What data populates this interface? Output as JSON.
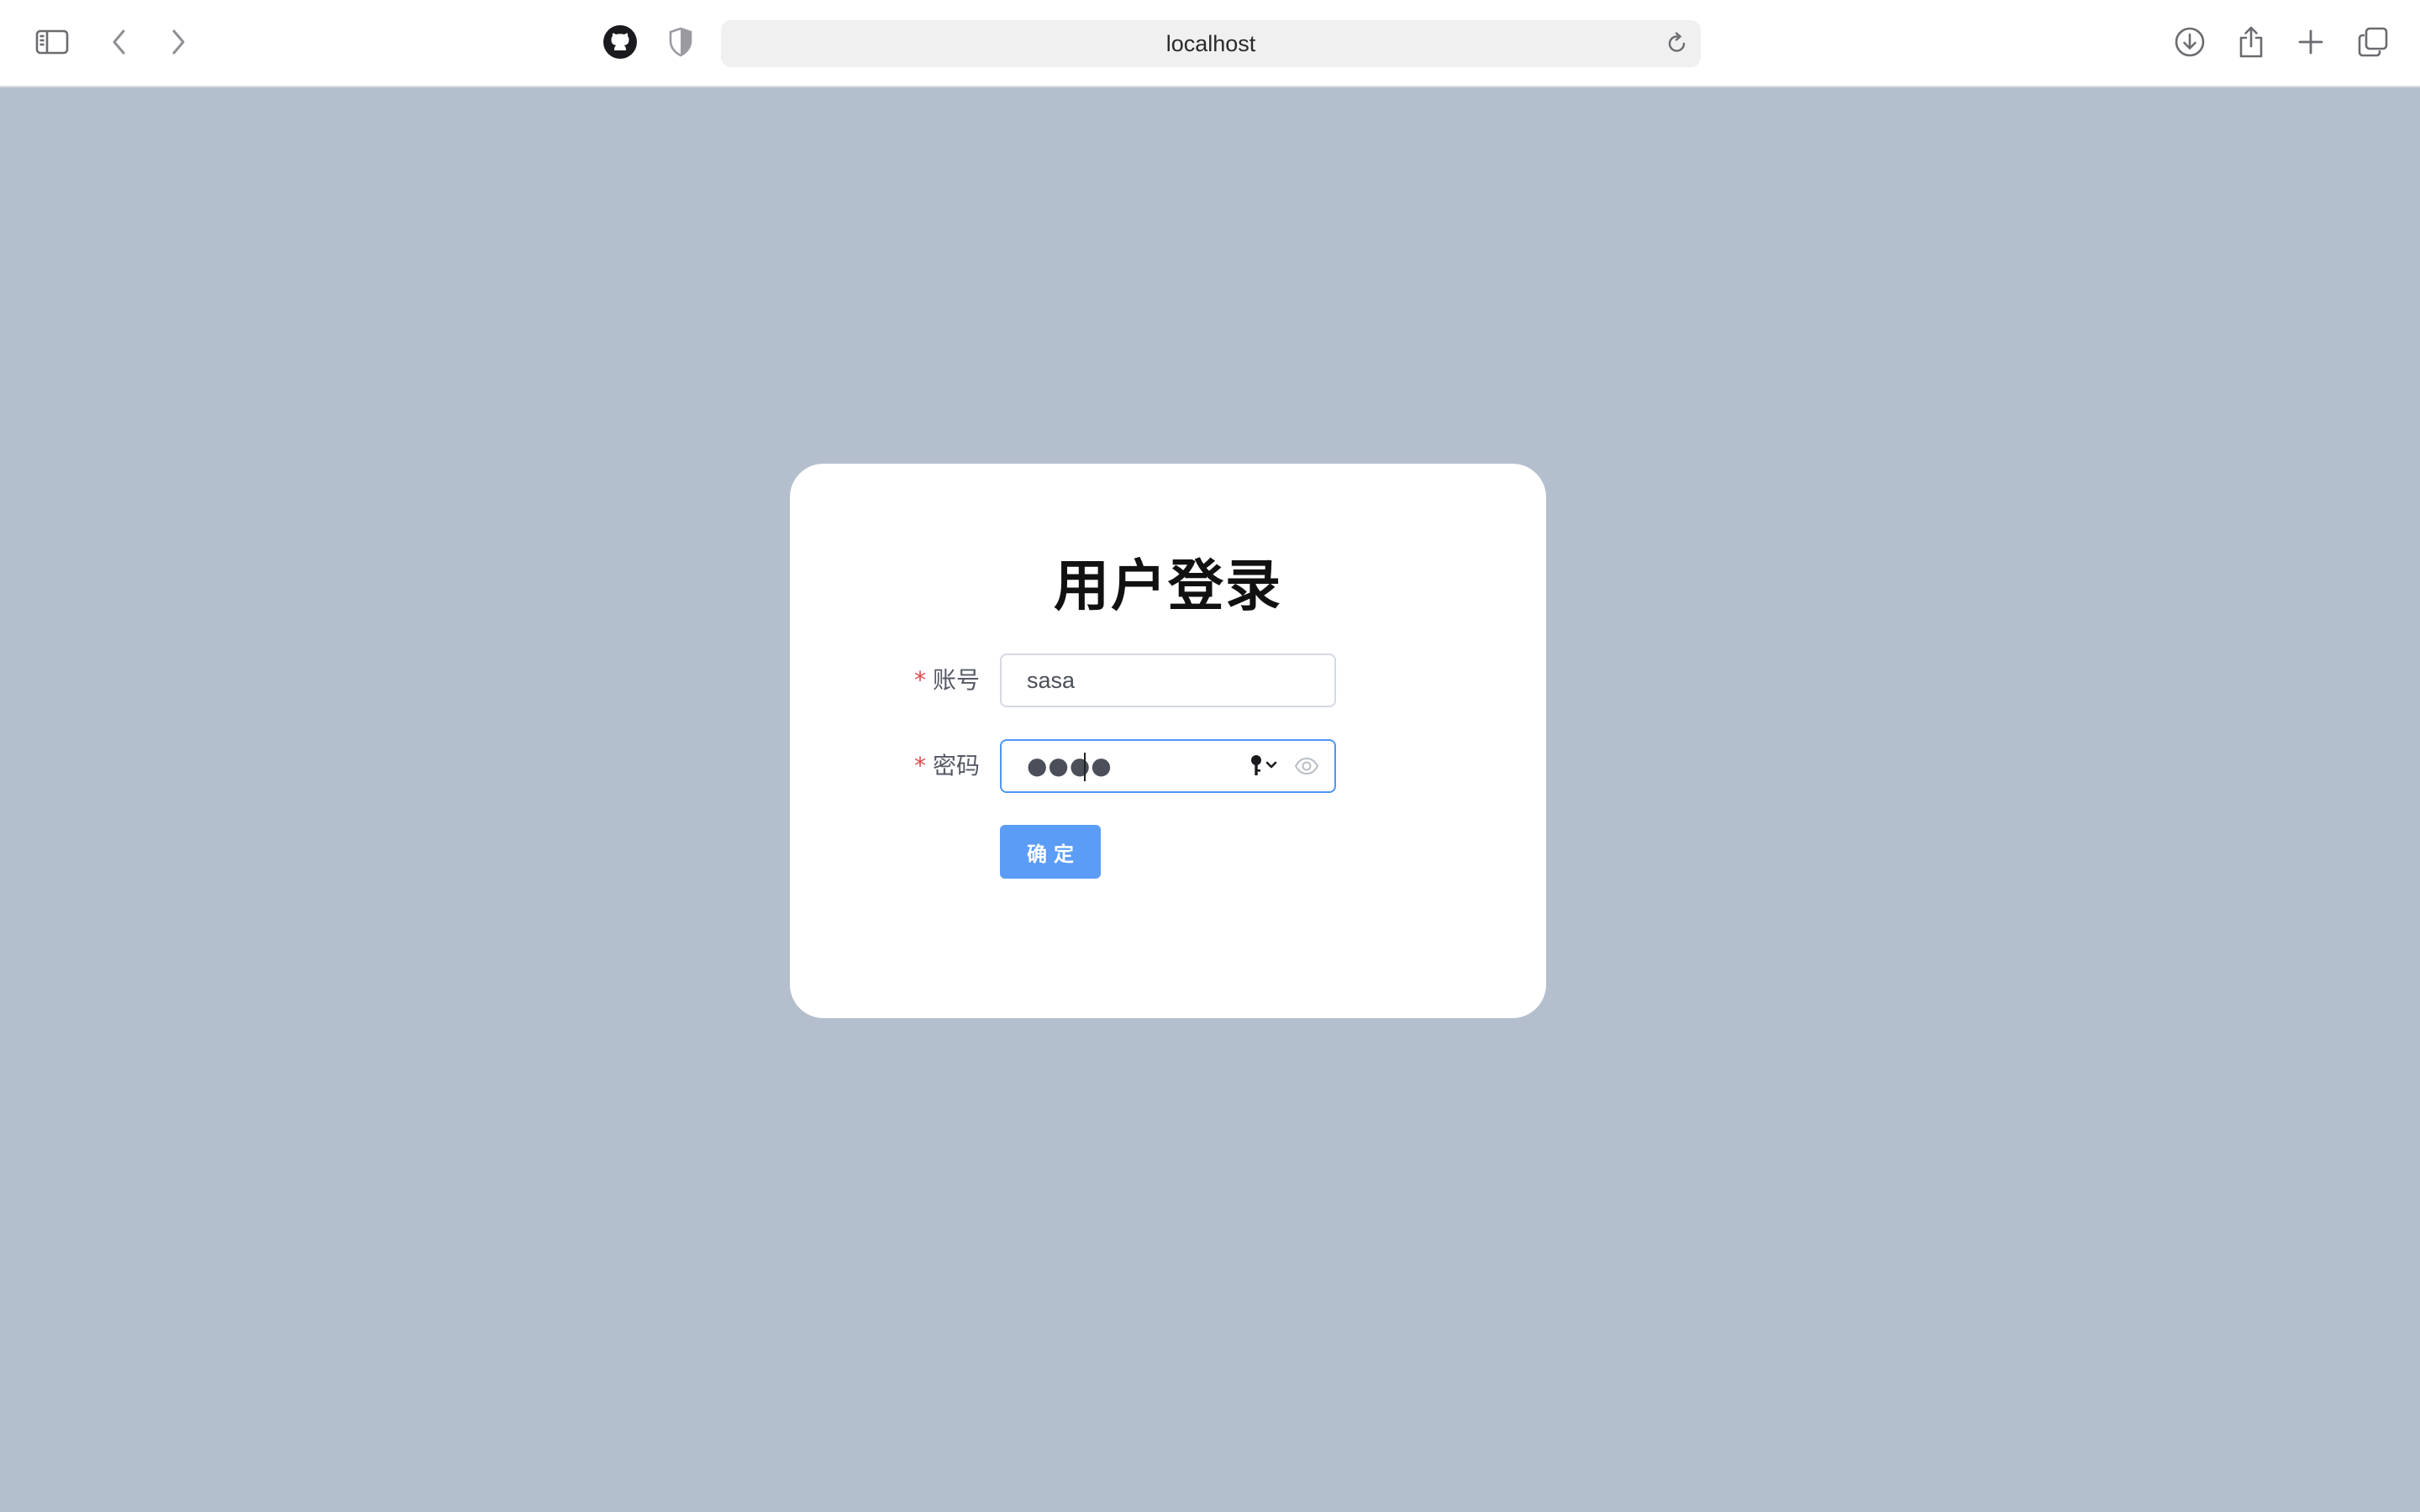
{
  "browser": {
    "address": "localhost",
    "icons": {
      "sidebar": "sidebar-icon",
      "back": "chevron-left-icon",
      "forward": "chevron-right-icon",
      "extension": "github-icon",
      "privacy": "shield-icon",
      "reload": "reload-icon",
      "download": "download-icon",
      "share": "share-icon",
      "new_tab": "plus-icon",
      "tabs": "tabs-overview-icon"
    }
  },
  "login": {
    "title": "用户登录",
    "account": {
      "label": "账号",
      "required_mark": "*",
      "value": "sasa"
    },
    "password": {
      "label": "密码",
      "required_mark": "*",
      "masked_value": "●●●●"
    },
    "submit_label": "确定"
  },
  "colors": {
    "page_background": "#b4bfce",
    "card_background": "#ffffff",
    "primary_button": "#5a9cf6",
    "focus_border": "#4f95f5",
    "required_star": "#e0484e"
  }
}
